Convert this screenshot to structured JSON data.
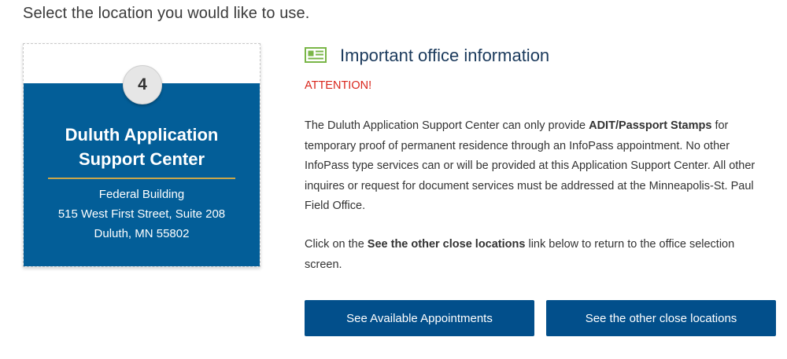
{
  "heading": "Select the location you would like to use.",
  "location_card": {
    "number": "4",
    "title_line1": "Duluth Application",
    "title_line2": "Support Center",
    "address_line1": "Federal Building",
    "address_line2": "515 West First Street, Suite 208",
    "address_line3": "Duluth, MN 55802",
    "colors": {
      "card_blue": "#035e98",
      "rule_gold": "#c9a64a"
    }
  },
  "office_info": {
    "icon": "newspaper-icon",
    "title": "Important office information",
    "attention": "ATTENTION!",
    "para1_part1": "The Duluth Application Support Center can only provide ",
    "para1_bold": "ADIT/Passport Stamps",
    "para1_part2": " for temporary proof of permanent residence through an InfoPass appointment. No other InfoPass type services can or will be provided at this Application Support Center. All other inquires or request for document services must be addressed at the Minneapolis-St. Paul Field Office.",
    "para2_part1": "Click on the ",
    "para2_bold": "See the other close locations",
    "para2_part2": " link below to return to the office selection screen.",
    "colors": {
      "attention": "#d9261c",
      "icon_green": "#7ab648",
      "title": "#1b3a5c"
    }
  },
  "buttons": {
    "appointments": "See Available Appointments",
    "other_locations": "See the other close locations",
    "color": "#024f8b"
  }
}
